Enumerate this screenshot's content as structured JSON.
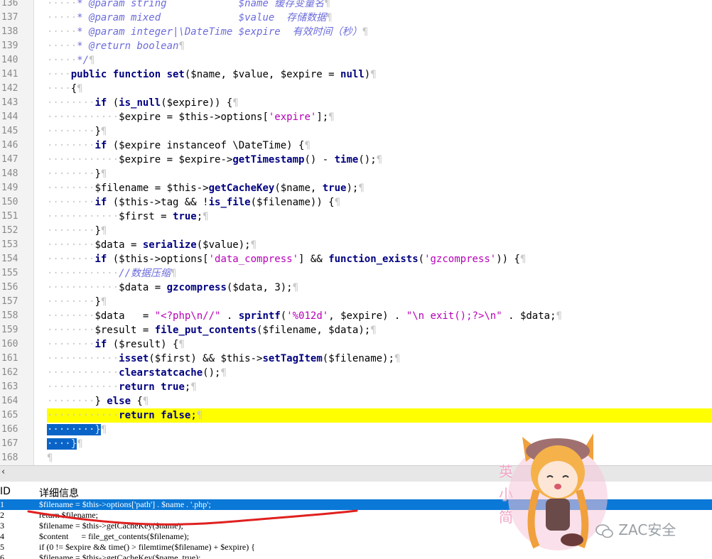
{
  "editor": {
    "lines": [
      {
        "n": "136",
        "segs": [
          [
            "ph",
            "·····"
          ],
          [
            "cm",
            "* @param string            $name 缓存变量名"
          ],
          [
            "ph",
            "¶"
          ]
        ]
      },
      {
        "n": "137",
        "segs": [
          [
            "ph",
            "·····"
          ],
          [
            "cm",
            "* @param mixed             $value  存储数据"
          ],
          [
            "ph",
            "¶"
          ]
        ]
      },
      {
        "n": "138",
        "segs": [
          [
            "ph",
            "·····"
          ],
          [
            "cm",
            "* @param integer|\\DateTime $expire  有效时间（秒）"
          ],
          [
            "ph",
            "¶"
          ]
        ]
      },
      {
        "n": "139",
        "segs": [
          [
            "ph",
            "·····"
          ],
          [
            "cm",
            "* @return boolean"
          ],
          [
            "ph",
            "¶"
          ]
        ]
      },
      {
        "n": "140",
        "segs": [
          [
            "ph",
            "·····"
          ],
          [
            "cm",
            "*/"
          ],
          [
            "ph",
            "¶"
          ]
        ]
      },
      {
        "n": "141",
        "segs": [
          [
            "ph",
            "····"
          ],
          [
            "kw",
            "public function "
          ],
          [
            "fn",
            "set"
          ],
          [
            "var",
            "($name, $value, $expire = "
          ],
          [
            "kw",
            "null"
          ],
          [
            "var",
            ")"
          ],
          [
            "ph",
            "¶"
          ]
        ]
      },
      {
        "n": "142",
        "segs": [
          [
            "ph",
            "····"
          ],
          [
            "var",
            "{"
          ],
          [
            "ph",
            "¶"
          ]
        ]
      },
      {
        "n": "143",
        "segs": [
          [
            "ph",
            "········"
          ],
          [
            "kw",
            "if "
          ],
          [
            "var",
            "("
          ],
          [
            "fn",
            "is_null"
          ],
          [
            "var",
            "($expire)) {"
          ],
          [
            "ph",
            "¶"
          ]
        ]
      },
      {
        "n": "144",
        "segs": [
          [
            "ph",
            "············"
          ],
          [
            "var",
            "$expire = $this->options["
          ],
          [
            "str",
            "'expire'"
          ],
          [
            "var",
            "];"
          ],
          [
            "ph",
            "¶"
          ]
        ]
      },
      {
        "n": "145",
        "segs": [
          [
            "ph",
            "········"
          ],
          [
            "var",
            "}"
          ],
          [
            "ph",
            "¶"
          ]
        ]
      },
      {
        "n": "146",
        "segs": [
          [
            "ph",
            "········"
          ],
          [
            "kw",
            "if "
          ],
          [
            "var",
            "($expire instanceof \\DateTime) {"
          ],
          [
            "ph",
            "¶"
          ]
        ]
      },
      {
        "n": "147",
        "segs": [
          [
            "ph",
            "············"
          ],
          [
            "var",
            "$expire = $expire->"
          ],
          [
            "fn",
            "getTimestamp"
          ],
          [
            "var",
            "() - "
          ],
          [
            "fn",
            "time"
          ],
          [
            "var",
            "();"
          ],
          [
            "ph",
            "¶"
          ]
        ]
      },
      {
        "n": "148",
        "segs": [
          [
            "ph",
            "········"
          ],
          [
            "var",
            "}"
          ],
          [
            "ph",
            "¶"
          ]
        ]
      },
      {
        "n": "149",
        "segs": [
          [
            "ph",
            "········"
          ],
          [
            "var",
            "$filename = $this->"
          ],
          [
            "fn",
            "getCacheKey"
          ],
          [
            "var",
            "($name, "
          ],
          [
            "kw",
            "true"
          ],
          [
            "var",
            ");"
          ],
          [
            "ph",
            "¶"
          ]
        ]
      },
      {
        "n": "150",
        "segs": [
          [
            "ph",
            "········"
          ],
          [
            "kw",
            "if "
          ],
          [
            "var",
            "($this->tag && !"
          ],
          [
            "fn",
            "is_file"
          ],
          [
            "var",
            "($filename)) {"
          ],
          [
            "ph",
            "¶"
          ]
        ]
      },
      {
        "n": "151",
        "segs": [
          [
            "ph",
            "············"
          ],
          [
            "var",
            "$first = "
          ],
          [
            "kw",
            "true"
          ],
          [
            "var",
            ";"
          ],
          [
            "ph",
            "¶"
          ]
        ]
      },
      {
        "n": "152",
        "segs": [
          [
            "ph",
            "········"
          ],
          [
            "var",
            "}"
          ],
          [
            "ph",
            "¶"
          ]
        ]
      },
      {
        "n": "153",
        "segs": [
          [
            "ph",
            "········"
          ],
          [
            "var",
            "$data = "
          ],
          [
            "fn",
            "serialize"
          ],
          [
            "var",
            "($value);"
          ],
          [
            "ph",
            "¶"
          ]
        ]
      },
      {
        "n": "154",
        "segs": [
          [
            "ph",
            "········"
          ],
          [
            "kw",
            "if "
          ],
          [
            "var",
            "($this->options["
          ],
          [
            "str",
            "'data_compress'"
          ],
          [
            "var",
            "] && "
          ],
          [
            "fn",
            "function_exists"
          ],
          [
            "var",
            "("
          ],
          [
            "str",
            "'gzcompress'"
          ],
          [
            "var",
            ")) {"
          ],
          [
            "ph",
            "¶"
          ]
        ]
      },
      {
        "n": "155",
        "segs": [
          [
            "ph",
            "············"
          ],
          [
            "cm",
            "//数据压缩"
          ],
          [
            "ph",
            "¶"
          ]
        ]
      },
      {
        "n": "156",
        "segs": [
          [
            "ph",
            "············"
          ],
          [
            "var",
            "$data = "
          ],
          [
            "fn",
            "gzcompress"
          ],
          [
            "var",
            "($data, 3);"
          ],
          [
            "ph",
            "¶"
          ]
        ]
      },
      {
        "n": "157",
        "segs": [
          [
            "ph",
            "········"
          ],
          [
            "var",
            "}"
          ],
          [
            "ph",
            "¶"
          ]
        ]
      },
      {
        "n": "158",
        "segs": [
          [
            "ph",
            "········"
          ],
          [
            "var",
            "$data   = "
          ],
          [
            "str",
            "\"<?php\\n//\""
          ],
          [
            "var",
            " . "
          ],
          [
            "fn",
            "sprintf"
          ],
          [
            "var",
            "("
          ],
          [
            "str",
            "'%012d'"
          ],
          [
            "var",
            ", $expire) . "
          ],
          [
            "str",
            "\"\\n exit();?>\\n\""
          ],
          [
            "var",
            " . $data;"
          ],
          [
            "ph",
            "¶"
          ]
        ]
      },
      {
        "n": "159",
        "segs": [
          [
            "ph",
            "········"
          ],
          [
            "var",
            "$result = "
          ],
          [
            "fn",
            "file_put_contents"
          ],
          [
            "var",
            "($filename, $data);"
          ],
          [
            "ph",
            "¶"
          ]
        ]
      },
      {
        "n": "160",
        "segs": [
          [
            "ph",
            "········"
          ],
          [
            "kw",
            "if "
          ],
          [
            "var",
            "($result) {"
          ],
          [
            "ph",
            "¶"
          ]
        ]
      },
      {
        "n": "161",
        "segs": [
          [
            "ph",
            "············"
          ],
          [
            "fn",
            "isset"
          ],
          [
            "var",
            "($first) && $this->"
          ],
          [
            "fn",
            "setTagItem"
          ],
          [
            "var",
            "($filename);"
          ],
          [
            "ph",
            "¶"
          ]
        ]
      },
      {
        "n": "162",
        "segs": [
          [
            "ph",
            "············"
          ],
          [
            "fn",
            "clearstatcache"
          ],
          [
            "var",
            "();"
          ],
          [
            "ph",
            "¶"
          ]
        ]
      },
      {
        "n": "163",
        "segs": [
          [
            "ph",
            "············"
          ],
          [
            "kw",
            "return true"
          ],
          [
            "var",
            ";"
          ],
          [
            "ph",
            "¶"
          ]
        ]
      },
      {
        "n": "164",
        "segs": [
          [
            "ph",
            "········"
          ],
          [
            "var",
            "} "
          ],
          [
            "kw",
            "else "
          ],
          [
            "var",
            "{"
          ],
          [
            "ph",
            "¶"
          ]
        ]
      },
      {
        "n": "165",
        "hl": true,
        "segs": [
          [
            "ph",
            "············"
          ],
          [
            "kw",
            "return false"
          ],
          [
            "var",
            ";"
          ],
          [
            "ph",
            "¶"
          ]
        ]
      },
      {
        "n": "166",
        "sel": true,
        "segs": [
          [
            "sel",
            "········}"
          ],
          [
            "ph",
            "¶"
          ]
        ]
      },
      {
        "n": "167",
        "sel": true,
        "segs": [
          [
            "sel",
            "····}"
          ],
          [
            "ph",
            "¶"
          ]
        ]
      },
      {
        "n": "168",
        "segs": [
          [
            "ph",
            "¶"
          ]
        ]
      }
    ]
  },
  "divider": {
    "arrow": "‹"
  },
  "results": {
    "col_id": "ID",
    "col_detail": "详细信息",
    "rows": [
      {
        "id": "1",
        "text": "$filename = $this->options['path'] . $name . '.php';",
        "selected": true
      },
      {
        "id": "2",
        "text": "return $filename;"
      },
      {
        "id": "3",
        "text": "$filename = $this->getCacheKey($name);"
      },
      {
        "id": "4",
        "text": "$content      = file_get_contents($filename);"
      },
      {
        "id": "5",
        "text": "if (0 != $expire && time() > filemtime($filename) + $expire) {"
      },
      {
        "id": "6",
        "text": "$filename = $this->getCacheKey($name, true);"
      }
    ]
  },
  "watermark": {
    "text": "ZAC安全"
  },
  "sticker_text": {
    "chars": [
      "英",
      "小",
      "简"
    ]
  },
  "colors": {
    "highlight": "#ffff00",
    "selection": "#0a64c8",
    "result_selection": "#0a78d7",
    "annotation": "#e02020"
  }
}
